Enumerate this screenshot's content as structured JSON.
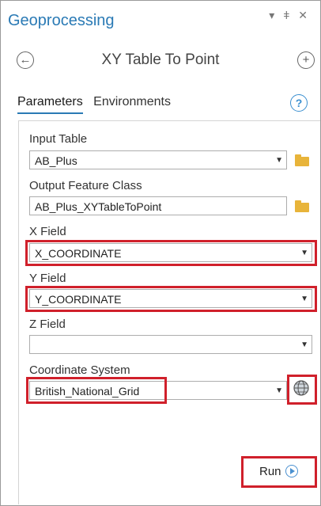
{
  "pane": {
    "title": "Geoprocessing",
    "controls": {
      "menu": "▾",
      "pin": "📌",
      "close": "✕"
    }
  },
  "tool": {
    "back_icon": "←",
    "title": "XY Table To Point",
    "add_icon": "+"
  },
  "tabs": [
    {
      "label": "Parameters",
      "active": true
    },
    {
      "label": "Environments",
      "active": false
    }
  ],
  "help_icon": "?",
  "params": {
    "input_table": {
      "label": "Input Table",
      "value": "AB_Plus"
    },
    "output_feature_class": {
      "label": "Output Feature Class",
      "value": "AB_Plus_XYTableToPoint"
    },
    "x_field": {
      "label": "X Field",
      "value": "X_COORDINATE"
    },
    "y_field": {
      "label": "Y Field",
      "value": "Y_COORDINATE"
    },
    "z_field": {
      "label": "Z Field",
      "value": ""
    },
    "coordinate_system": {
      "label": "Coordinate System",
      "value": "British_National_Grid"
    }
  },
  "run_button": {
    "label": "Run"
  },
  "colors": {
    "title_blue": "#2a7ab5",
    "highlight_red": "#d0202b",
    "folder": "#e8b43a",
    "accent_blue": "#4a90d0"
  },
  "icons": [
    "chevron-down-icon",
    "pin-icon",
    "close-icon",
    "back-arrow-icon",
    "add-icon",
    "help-icon",
    "folder-icon",
    "dropdown-arrow-icon",
    "globe-icon",
    "play-icon"
  ]
}
